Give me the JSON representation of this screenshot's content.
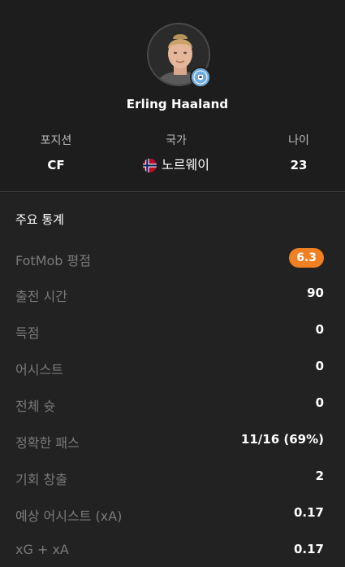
{
  "player": {
    "name": "Erling Haaland",
    "club_badge_icon": "manchester-city-badge-icon"
  },
  "info": {
    "position_label": "포지션",
    "position_value": "CF",
    "country_label": "국가",
    "country_value": "노르웨이",
    "country_flag_icon": "norway-flag-icon",
    "age_label": "나이",
    "age_value": "23"
  },
  "stats": {
    "title": "주요 통계",
    "rating_color": "#f08022",
    "rows": [
      {
        "label": "FotMob 평점",
        "value": "6.3"
      },
      {
        "label": "출전 시간",
        "value": "90"
      },
      {
        "label": "득점",
        "value": "0"
      },
      {
        "label": "어시스트",
        "value": "0"
      },
      {
        "label": "전체 슛",
        "value": "0"
      },
      {
        "label": "정확한 패스",
        "value": "11/16 (69%)"
      },
      {
        "label": "기회 창출",
        "value": "2"
      },
      {
        "label": "예상 어시스트 (xA)",
        "value": "0.17"
      },
      {
        "label": "xG + xA",
        "value": "0.17"
      }
    ]
  }
}
